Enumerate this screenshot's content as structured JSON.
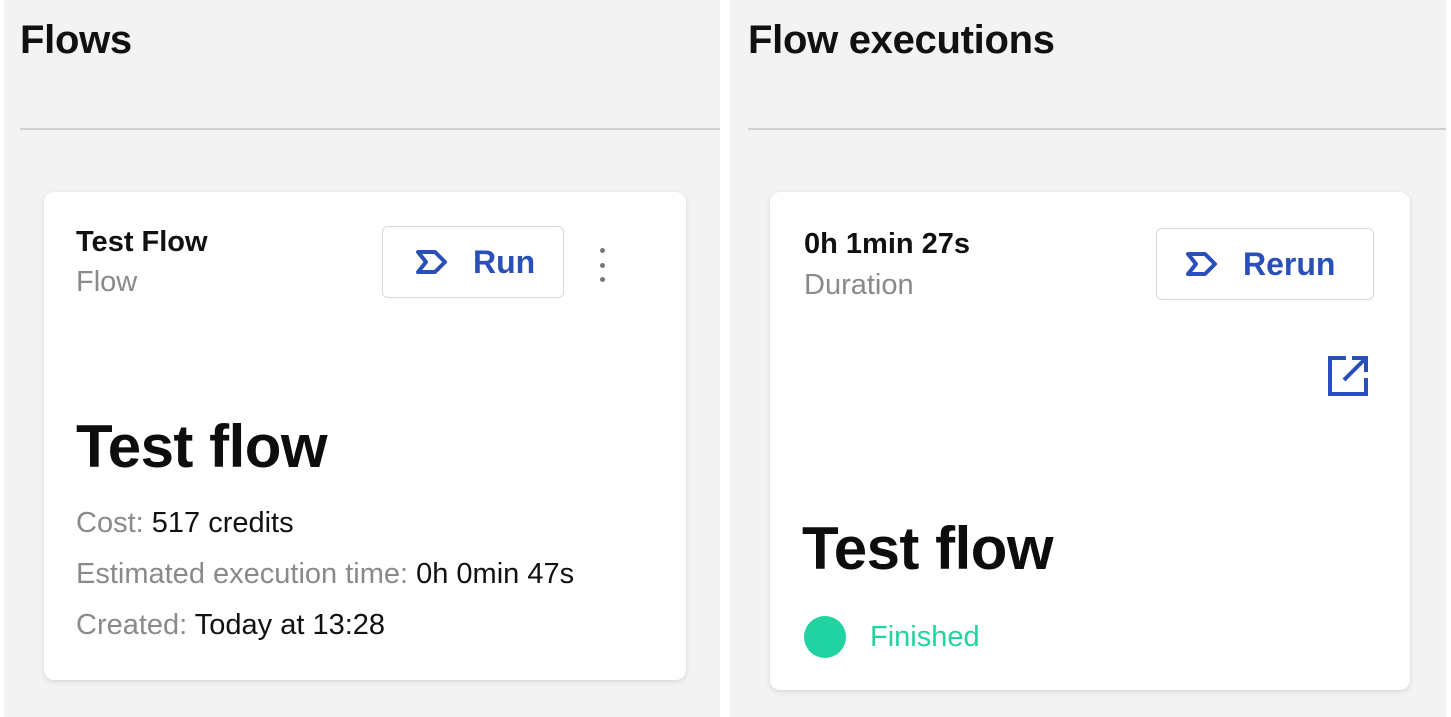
{
  "flows_panel": {
    "title": "Flows",
    "card": {
      "name": "Test Flow",
      "type_label": "Flow",
      "run_label": "Run",
      "big_title": "Test flow",
      "cost": {
        "label": "Cost:",
        "value": "517 credits"
      },
      "estimated": {
        "label": "Estimated execution time:",
        "value": "0h 0min 47s"
      },
      "created": {
        "label": "Created:",
        "value": "Today at 13:28"
      }
    }
  },
  "executions_panel": {
    "title": "Flow executions",
    "card": {
      "duration_value": "0h 1min 27s",
      "duration_label": "Duration",
      "rerun_label": "Rerun",
      "big_title": "Test flow",
      "status_text": "Finished"
    }
  },
  "icons": {
    "run": "play-chevron-icon",
    "rerun": "play-chevron-icon",
    "more": "more-vertical-icon",
    "open": "open-external-icon"
  },
  "colors": {
    "accent": "#2a4fb8",
    "status_finished": "#21d3a0",
    "panel_bg": "#f3f3f3",
    "muted_text": "#8a8a8a"
  }
}
